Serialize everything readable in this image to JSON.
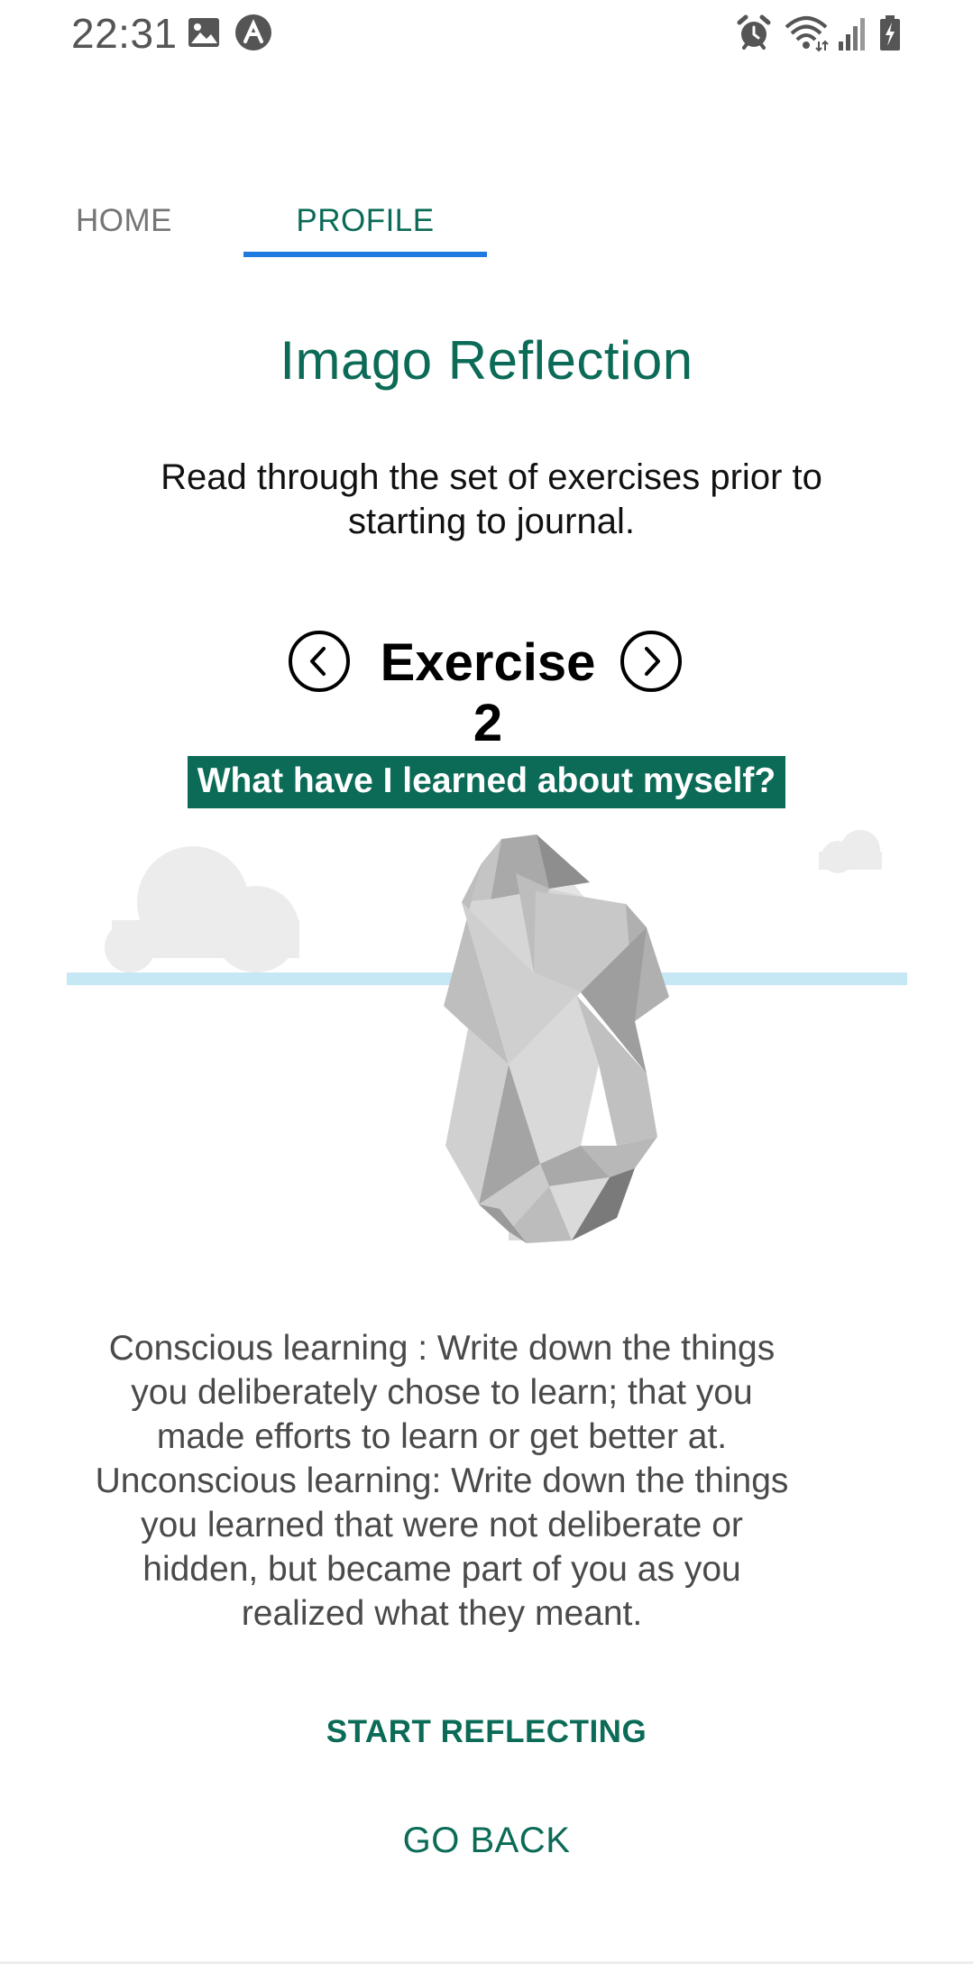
{
  "status_bar": {
    "time": "22:31",
    "left_icons": [
      "image-icon",
      "app-notification-icon"
    ],
    "right_icons": [
      "alarm-icon",
      "wifi-icon",
      "signal-icon",
      "battery-charging-icon"
    ]
  },
  "tabs": [
    {
      "label": "HOME",
      "active": false
    },
    {
      "label": "PROFILE",
      "active": true
    }
  ],
  "page": {
    "title": "Imago Reflection",
    "intro": "Read through the set of exercises prior to starting to journal.",
    "exercise_title": "Exercise 2",
    "question": "What have I learned about myself?",
    "description": "Conscious learning : Write down the things you deliberately chose to learn; that you made efforts to learn or get better at. Unconscious learning: Write down the things you learned that were not deliberate or hidden, but became part of you as you realized what they meant."
  },
  "buttons": {
    "start": "START REFLECTING",
    "back": "GO BACK"
  },
  "colors": {
    "accent": "#0b6b57",
    "tab_indicator": "#1f7ae0",
    "water_line": "#c6e8f5"
  }
}
